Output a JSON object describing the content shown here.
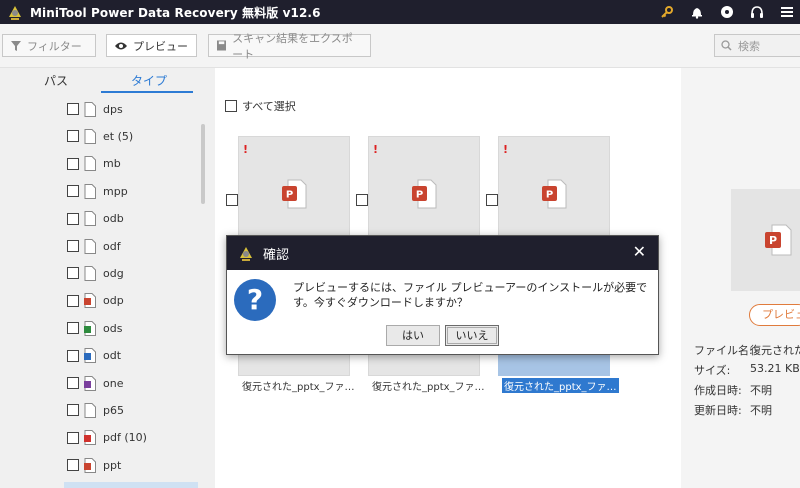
{
  "app": {
    "title": "MiniTool Power Data Recovery 無料版 v12.6"
  },
  "titlebar_icons": [
    "key-icon",
    "bell-icon",
    "disc-icon",
    "headset-icon",
    "menu-icon"
  ],
  "toolbar": {
    "filter_label": "フィルター",
    "preview_label": "プレビュー",
    "export_label": "スキャン結果をエクスポート",
    "search_placeholder": "検索"
  },
  "tabs": [
    {
      "label": "パス"
    },
    {
      "label": "タイプ"
    }
  ],
  "tree": [
    {
      "label": "dps"
    },
    {
      "label": "et (5)"
    },
    {
      "label": "mb"
    },
    {
      "label": "mpp"
    },
    {
      "label": "odb"
    },
    {
      "label": "odf"
    },
    {
      "label": "odg"
    },
    {
      "label": "odp"
    },
    {
      "label": "ods"
    },
    {
      "label": "odt"
    },
    {
      "label": "one"
    },
    {
      "label": "p65"
    },
    {
      "label": "pdf (10)"
    },
    {
      "label": "ppt"
    }
  ],
  "main": {
    "select_all_label": "すべて選択",
    "files": [
      {
        "name": "復元された_pptx_ファ…"
      },
      {
        "name": "復元された_pptx_ファ…"
      },
      {
        "name": "復元された_pptx_ファ…"
      }
    ]
  },
  "details": {
    "preview_button": "プレビュー",
    "props": [
      {
        "key": "ファイル名:",
        "value": "復元された_"
      },
      {
        "key": "サイズ:",
        "value": "53.21 KB"
      },
      {
        "key": "作成日時:",
        "value": "不明"
      },
      {
        "key": "更新日時:",
        "value": "不明"
      }
    ]
  },
  "dialog": {
    "title": "確認",
    "message": "プレビューするには、ファイル プレビューアーのインストールが必要です。今すぐダウンロードしますか？",
    "yes_label": "はい",
    "no_label": "いいえ",
    "close_glyph": "✕",
    "icon_glyph": "?"
  },
  "colors": {
    "titlebar": "#1f1f2d",
    "accent": "#2d7bd4",
    "preview_orange": "#e07b3c",
    "selection": "#2f79cf"
  }
}
